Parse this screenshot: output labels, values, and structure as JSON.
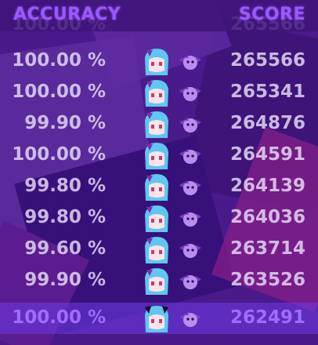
{
  "header": {
    "accuracy_label": "ACCURACY",
    "score_label": "SCORE"
  },
  "rows": [
    {
      "accuracy": "100.00 %",
      "score": "265566",
      "avatar": "blue-hair-girl-icon",
      "pet": "purple-bat-pet-icon"
    },
    {
      "accuracy": "100.00 %",
      "score": "265341",
      "avatar": "blue-hair-girl-icon",
      "pet": "purple-bat-pet-icon"
    },
    {
      "accuracy": "99.90 %",
      "score": "264876",
      "avatar": "blue-hair-girl-icon",
      "pet": "purple-bat-pet-icon"
    },
    {
      "accuracy": "100.00 %",
      "score": "264591",
      "avatar": "blue-hair-girl-icon",
      "pet": "purple-bat-pet-icon"
    },
    {
      "accuracy": "99.80 %",
      "score": "264139",
      "avatar": "blue-hair-girl-icon",
      "pet": "purple-bat-pet-icon"
    },
    {
      "accuracy": "99.80 %",
      "score": "264036",
      "avatar": "blue-hair-girl-icon",
      "pet": "purple-bat-pet-icon"
    },
    {
      "accuracy": "99.60 %",
      "score": "263714",
      "avatar": "blue-hair-girl-icon",
      "pet": "purple-bat-pet-icon"
    },
    {
      "accuracy": "99.90 %",
      "score": "263526",
      "avatar": "blue-hair-girl-icon",
      "pet": "purple-bat-pet-icon"
    }
  ],
  "highlighted_row": {
    "accuracy": "100.00 %",
    "score": "262491",
    "avatar": "demon-girl-icon",
    "pet": "purple-bat-pet-icon"
  },
  "colors": {
    "background": "#4a1a8a",
    "header_text": "#9a58ff",
    "row_text": "#e8def8",
    "highlight_bg": "#6e3ce6",
    "highlight_text": "#9f6cff"
  }
}
